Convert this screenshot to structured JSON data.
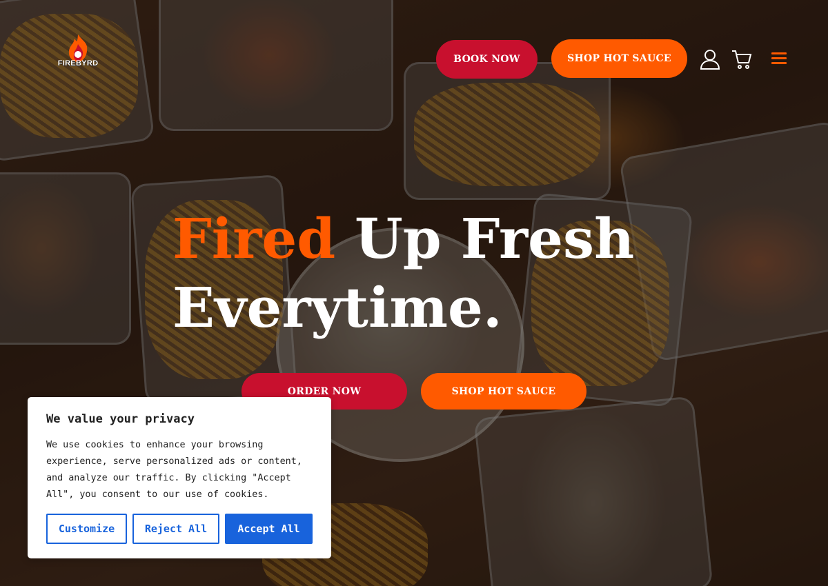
{
  "header": {
    "logo_alt": "FIREBYRD",
    "book_now_label": "BOOK NOW",
    "shop_hot_sauce_label": "SHOP HOT SAUCE",
    "icons": [
      "user-icon",
      "cart-icon",
      "hamburger-menu-icon"
    ]
  },
  "hero": {
    "title_accent": "Fired",
    "title_rest": "Up Fresh",
    "title_line2": "Everytime.",
    "order_now_label": "ORDER NOW",
    "shop_hot_sauce_label": "SHOP HOT SAUCE"
  },
  "cookie_banner": {
    "title": "We value your privacy",
    "body": "We use cookies to enhance your browsing experience, serve personalized ads or content, and analyze our traffic. By clicking \"Accept All\", you consent to our use of cookies.",
    "customize_label": "Customize",
    "reject_label": "Reject All",
    "accept_label": "Accept All"
  },
  "colors": {
    "brand_red": "#c8102e",
    "brand_orange": "#ff5a00",
    "cookie_blue": "#1863dc"
  }
}
